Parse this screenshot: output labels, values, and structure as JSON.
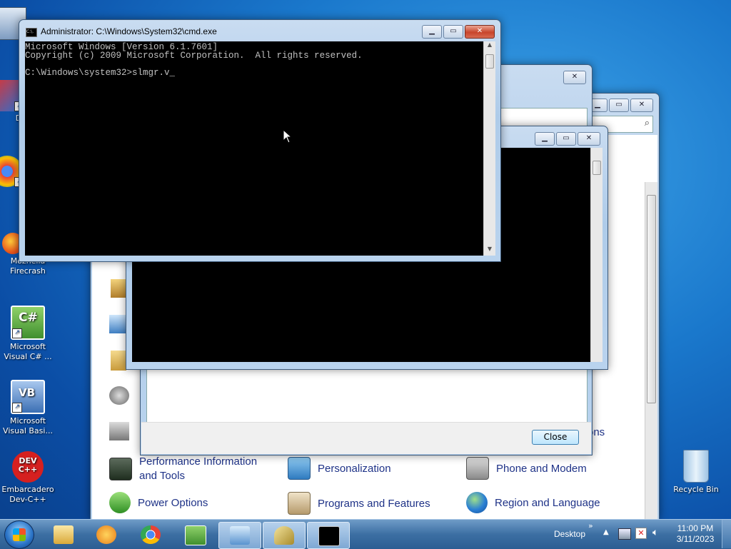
{
  "desktop": {
    "icons": [
      {
        "label": "My"
      },
      {
        "label": "Data"
      },
      {
        "label": "Gl"
      },
      {
        "label": "Mozhella Firecrash"
      },
      {
        "label": "Microsoft Visual C# ..."
      },
      {
        "label": "Microsoft Visual Basi..."
      },
      {
        "label": "Embarcadero Dev-C++"
      },
      {
        "label": "Recycle Bin"
      }
    ],
    "devcpp_badge": "DEV C++",
    "csharp_badge": "C#",
    "vb_badge": "VB"
  },
  "cmd_window": {
    "title": "Administrator: C:\\Windows\\System32\\cmd.exe",
    "title_icon": "C:\\.",
    "lines": [
      "Microsoft Windows [Version 6.1.7601]",
      "Copyright (c) 2009 Microsoft Corporation.  All rights reserved.",
      "",
      "C:\\Windows\\system32>slmgr.v_"
    ]
  },
  "dialog_window": {
    "close_button": "Close"
  },
  "control_panel": {
    "items": [
      {
        "label": "Performance Information and Tools",
        "icon": "performance-icon"
      },
      {
        "label": "Personalization",
        "icon": "personalization-icon"
      },
      {
        "label": "Phone and Modem",
        "icon": "phone-modem-icon"
      },
      {
        "label": "Power Options",
        "icon": "power-icon"
      },
      {
        "label": "Programs and Features",
        "icon": "programs-icon"
      },
      {
        "label": "Region and Language",
        "icon": "region-icon"
      }
    ],
    "partial_text": "ons"
  },
  "taskbar": {
    "desktop_label": "Desktop",
    "chevron": "»",
    "time": "11:00 PM",
    "date": "3/11/2023"
  },
  "colors": {
    "cp_link": "#1e3287",
    "console_bg": "#000000",
    "console_text": "#c0c0c0"
  }
}
